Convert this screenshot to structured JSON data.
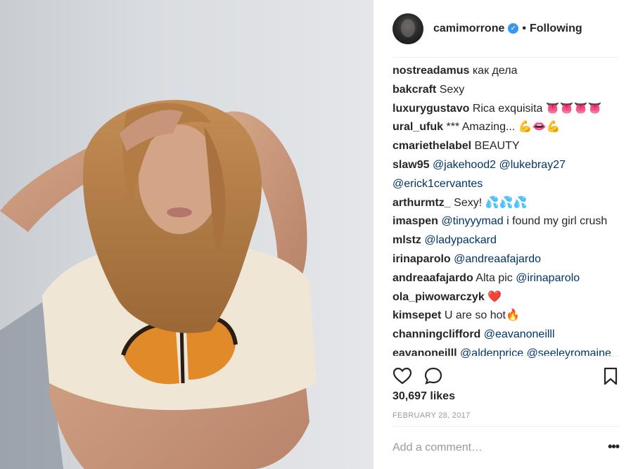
{
  "post": {
    "username": "camimorrone",
    "verified_badge": "✓",
    "separator": "•",
    "follow_status": "Following"
  },
  "comments": [
    {
      "user": "nostreadamus",
      "text": "как дела",
      "mention": ""
    },
    {
      "user": "bakcraft",
      "text": "Sexy",
      "mention": ""
    },
    {
      "user": "luxurygustavo",
      "text": "Rica exquisita 👅👅👅👅",
      "mention": ""
    },
    {
      "user": "ural_ufuk",
      "text": "*** Amazing... 💪👄💪",
      "mention": ""
    },
    {
      "user": "cmariethelabel",
      "text": "BEAUTY",
      "mention": ""
    },
    {
      "user": "slaw95",
      "text": "",
      "mention": "@jakehood2 @lukebray27"
    },
    {
      "user": "",
      "text": "",
      "mention": "@erick1cervantes"
    },
    {
      "user": "arthurmtz_",
      "text": "Sexy! 💦💦💦",
      "mention": ""
    },
    {
      "user": "imaspen",
      "text": "i found my girl crush",
      "mention": "@tinyyymad"
    },
    {
      "user": "mlstz",
      "text": "",
      "mention": "@ladypackard"
    },
    {
      "user": "irinaparolo",
      "text": "",
      "mention": "@andreaafajardo"
    },
    {
      "user": "andreaafajardo",
      "text": "Alta pic",
      "mention": "@irinaparolo"
    },
    {
      "user": "ola_piwowarczyk",
      "text": "❤️",
      "mention": ""
    },
    {
      "user": "kimsepet",
      "text": "U are so hot🔥",
      "mention": ""
    },
    {
      "user": "channingclifford",
      "text": "",
      "mention": "@eavanoneilll"
    },
    {
      "user": "eavanoneilll",
      "text": "",
      "mention": "@aldenprice @seeleyromaine"
    }
  ],
  "likes": "30,697 likes",
  "date": "FEBRUARY 28, 2017",
  "add_comment": {
    "placeholder": "Add a comment…",
    "more": "•••"
  },
  "icons": {
    "like": "heart-icon",
    "comment": "speech-bubble-icon",
    "save": "bookmark-icon",
    "more": "ellipsis-icon"
  },
  "colors": {
    "mention": "#003569",
    "verified": "#3897f0",
    "heart": "#e0245e"
  }
}
